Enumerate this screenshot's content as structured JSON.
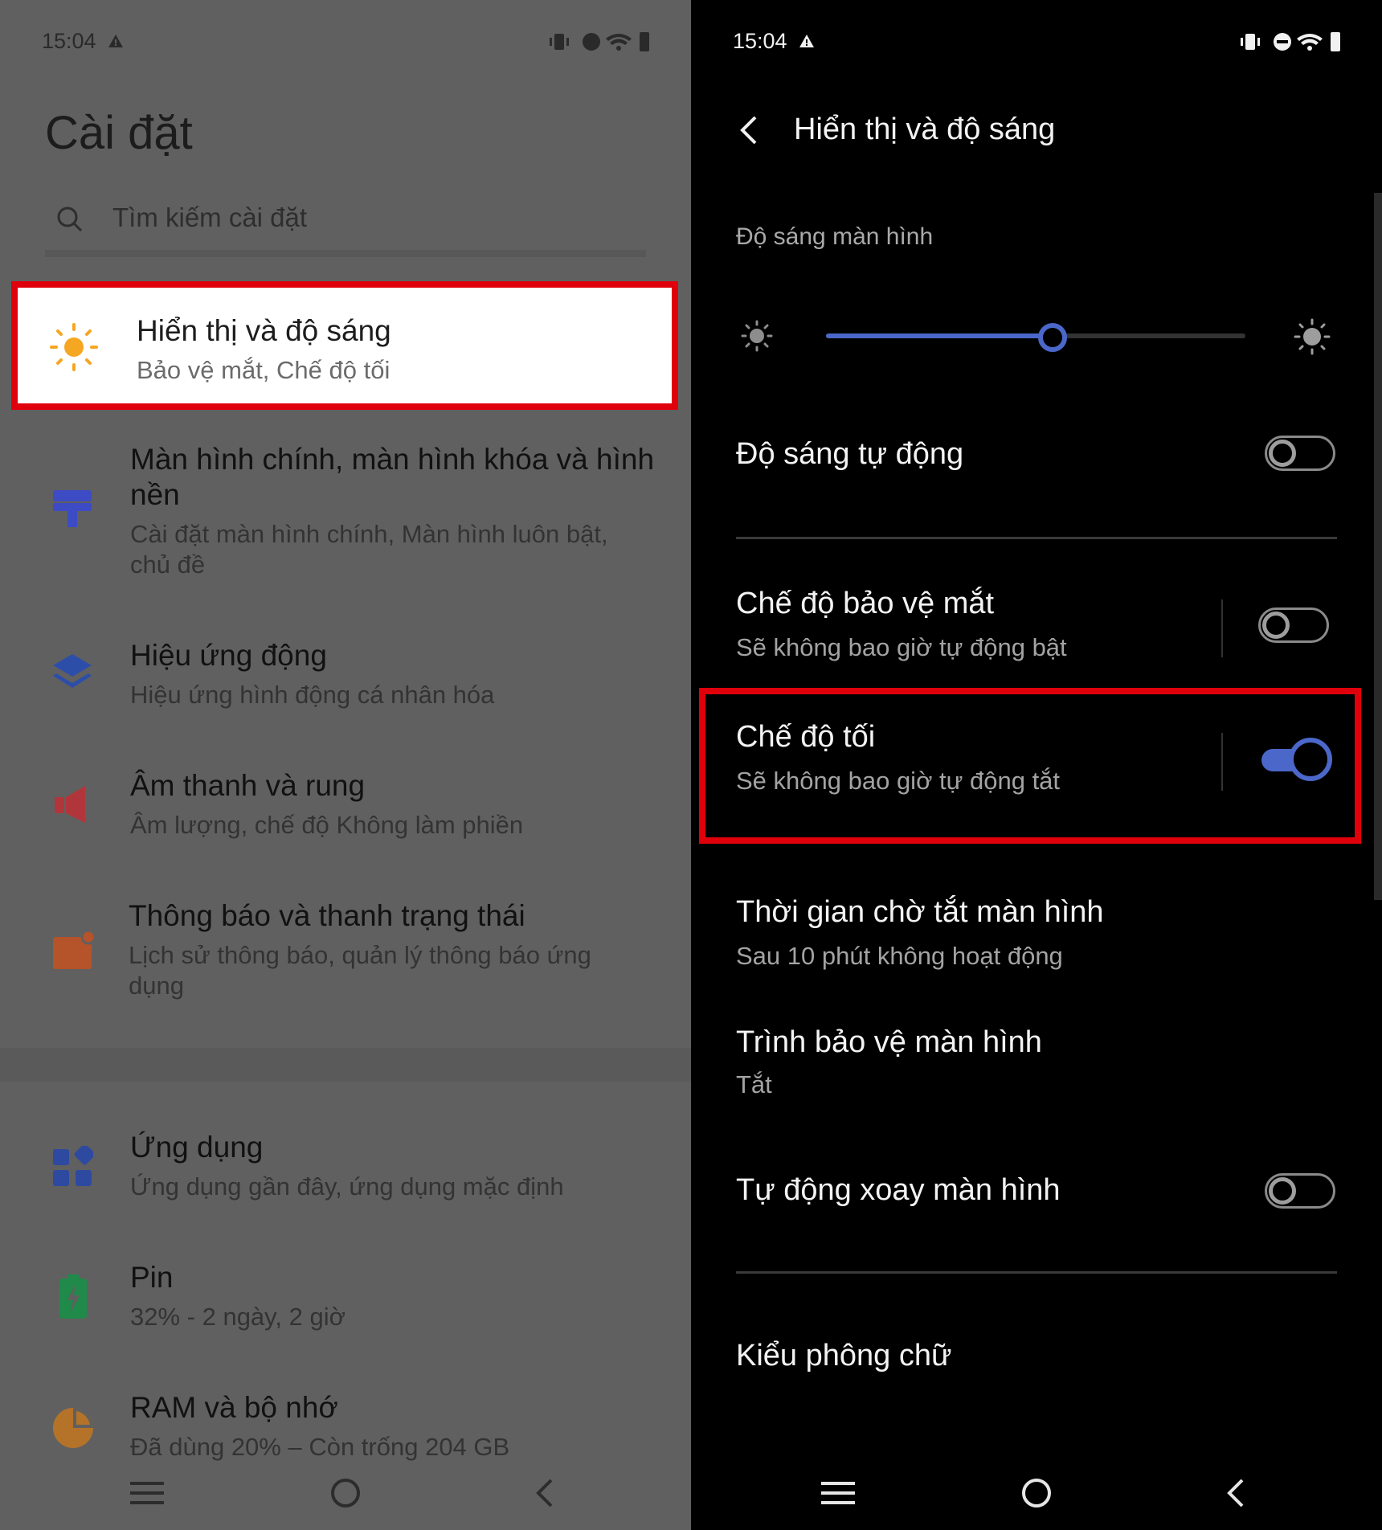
{
  "left": {
    "status_time": "15:04",
    "title": "Cài đặt",
    "search_placeholder": "Tìm kiếm cài đặt",
    "items": [
      {
        "title": "Hiển thị và độ sáng",
        "subtitle": "Bảo vệ mắt, Chế độ tối",
        "icon": "sun-icon",
        "color": "#f5a623"
      },
      {
        "title": "Màn hình chính, màn hình khóa và hình nền",
        "subtitle": "Cài đặt màn hình chính, Màn hình luôn bật, chủ đề",
        "icon": "wallpaper-icon",
        "color": "#3d4bc4"
      },
      {
        "title": "Hiệu ứng động",
        "subtitle": "Hiệu ứng hình động cá nhân hóa",
        "icon": "layers-icon",
        "color": "#2d4ea8"
      },
      {
        "title": "Âm thanh và rung",
        "subtitle": "Âm lượng, chế độ Không làm phiền",
        "icon": "speaker-icon",
        "color": "#b1363c"
      },
      {
        "title": "Thông báo và thanh trạng thái",
        "subtitle": "Lịch sử thông báo, quản lý thông báo ứng dụng",
        "icon": "notification-icon",
        "color": "#b5532a"
      },
      {
        "title": "Ứng dụng",
        "subtitle": "Ứng dụng gần đây, ứng dụng mặc định",
        "icon": "apps-icon",
        "color": "#2d4aa0"
      },
      {
        "title": "Pin",
        "subtitle": "32% - 2 ngày, 2 giờ",
        "icon": "battery-icon",
        "color": "#1f8a4a"
      },
      {
        "title": "RAM và bộ nhớ",
        "subtitle": "Đã dùng 20% – Còn trống 204 GB",
        "icon": "storage-pie-icon",
        "color": "#b5732a"
      }
    ]
  },
  "right": {
    "status_time": "15:04",
    "header_title": "Hiển thị và độ sáng",
    "brightness_label": "Độ sáng màn hình",
    "brightness_level": 0.54,
    "auto_brightness": {
      "title": "Độ sáng tự động",
      "on": false
    },
    "eye_protection": {
      "title": "Chế độ bảo vệ mắt",
      "subtitle": "Sẽ không bao giờ tự động bật",
      "on": false
    },
    "dark_mode": {
      "title": "Chế độ tối",
      "subtitle": "Sẽ không bao giờ tự động tắt",
      "on": true
    },
    "screen_timeout": {
      "title": "Thời gian chờ tắt màn hình",
      "subtitle": "Sau 10 phút không hoạt động"
    },
    "screensaver": {
      "title": "Trình bảo vệ màn hình",
      "subtitle": "Tắt"
    },
    "auto_rotate": {
      "title": "Tự động xoay màn hình",
      "on": false
    },
    "font_style": {
      "title": "Kiểu phông chữ"
    }
  },
  "colors": {
    "highlight": "#e0000b",
    "accent": "#4a67c9"
  }
}
